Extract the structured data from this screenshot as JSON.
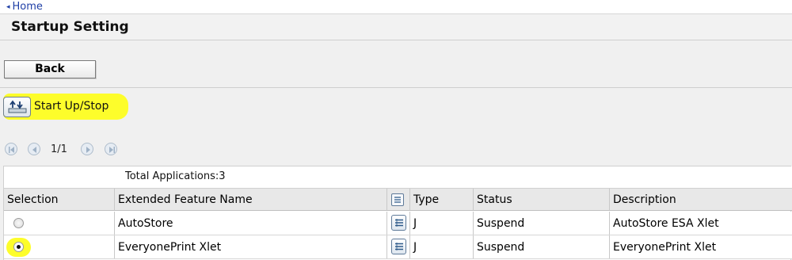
{
  "nav": {
    "home_label": "Home"
  },
  "page": {
    "title": "Startup Setting"
  },
  "toolbar": {
    "back_label": "Back",
    "startup_stop_label": "Start Up/Stop"
  },
  "pager": {
    "indicator": "1/1"
  },
  "table": {
    "total_label": "Total Applications:3",
    "headers": {
      "selection": "Selection",
      "name": "Extended Feature Name",
      "type": "Type",
      "status": "Status",
      "description": "Description"
    },
    "rows": [
      {
        "selected": false,
        "name": "AutoStore",
        "type": "J",
        "status": "Suspend",
        "description": "AutoStore ESA Xlet"
      },
      {
        "selected": true,
        "name": "EveryonePrint Xlet",
        "type": "J",
        "status": "Suspend",
        "description": "EveryonePrint Xlet"
      }
    ]
  },
  "colors": {
    "highlight": "#fdfd2b",
    "link": "#1f3fa6"
  },
  "icons": {
    "home": "left-caret-icon",
    "startup": "startup-stop-icon",
    "pager": [
      "first-page-icon",
      "prev-page-icon",
      "next-page-icon",
      "last-page-icon"
    ],
    "detail": "details-list-icon"
  }
}
